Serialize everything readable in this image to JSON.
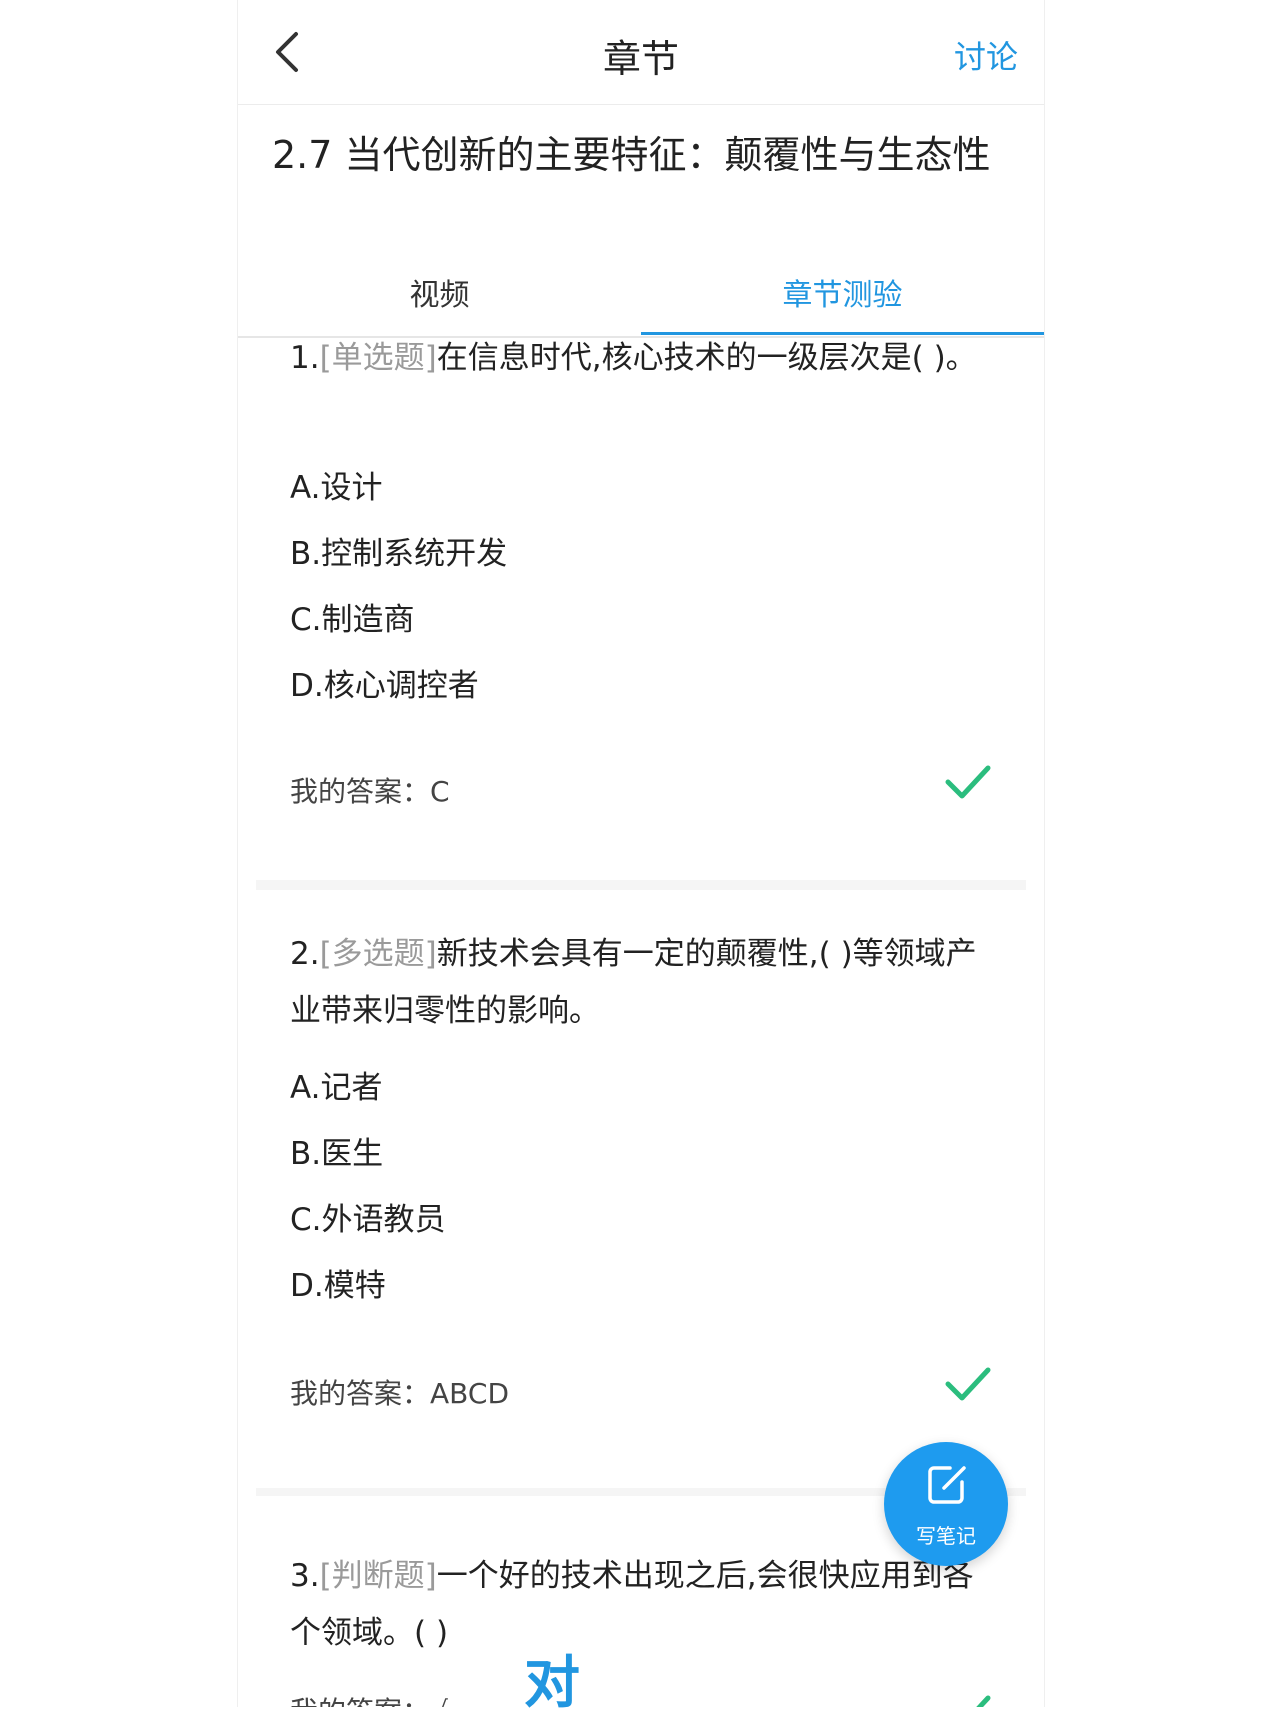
{
  "navbar": {
    "title": "章节",
    "action": "讨论"
  },
  "chapter_title": "2.7 当代创新的主要特征：颠覆性与生态性",
  "tabs": [
    {
      "label": "视频"
    },
    {
      "label": "章节测验"
    }
  ],
  "questions": [
    {
      "number": "1.",
      "type": "[单选题]",
      "text": "在信息时代,核心技术的一级层次是(   )。",
      "options": [
        "A.设计",
        "B.控制系统开发",
        "C.制造商",
        "D.核心调控者"
      ],
      "answer_label": "我的答案：",
      "answer": "C"
    },
    {
      "number": "2.",
      "type": "[多选题]",
      "text": "新技术会具有一定的颠覆性,( )等领域产业带来归零性的影响。",
      "options": [
        "A.记者",
        "B.医生",
        "C.外语教员",
        "D.模特"
      ],
      "answer_label": "我的答案：",
      "answer": "ABCD"
    },
    {
      "number": "3.",
      "type": "[判断题]",
      "text": "一个好的技术出现之后,会很快应用到各个领域。( )",
      "answer_label": "我的答案：",
      "answer": "√"
    }
  ],
  "fab": {
    "label": "写笔记"
  },
  "overlay_text": "对",
  "colors": {
    "accent": "#2196e0",
    "check": "#2bbd7e",
    "type_label": "#9a9a9a"
  }
}
